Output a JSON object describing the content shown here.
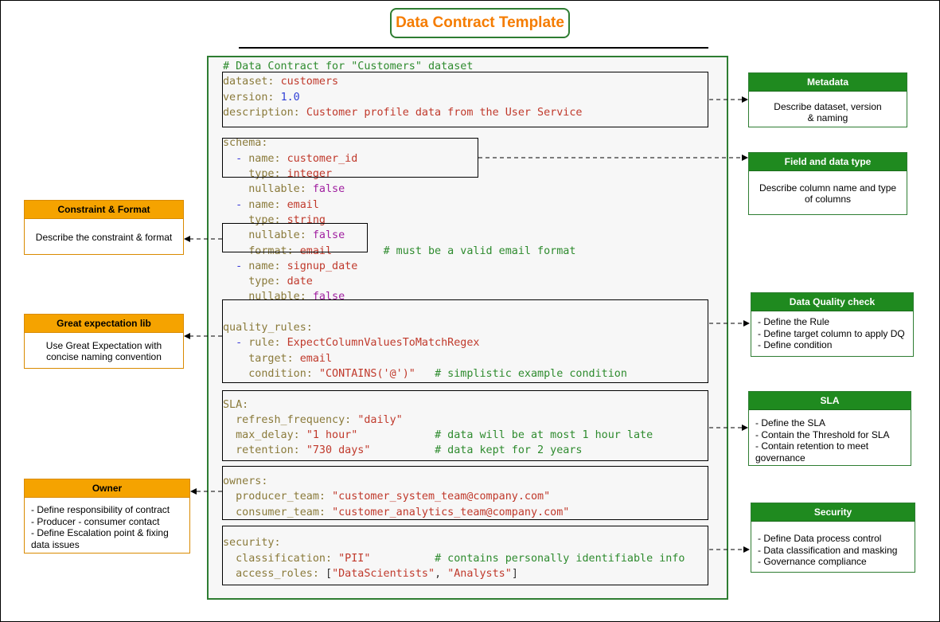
{
  "title": "Data Contract Template",
  "code": {
    "comment": "# Data Contract for \"Customers\" dataset",
    "dataset_key": "dataset:",
    "dataset_val": "customers",
    "version_key": "version:",
    "version_val": "1.0",
    "description_key": "description:",
    "description_val": "Customer profile data from the User Service",
    "schema_key": "schema:",
    "dash": "-",
    "name_key": "name:",
    "type_key": "type:",
    "nullable_key": "nullable:",
    "format_key": "format:",
    "false_val": "false",
    "field1_name": "customer_id",
    "field1_type": "integer",
    "field2_name": "email",
    "field2_type": "string",
    "field2_format": "email",
    "field2_comment": "# must be a valid email format",
    "field3_name": "signup_date",
    "field3_type": "date",
    "quality_key": "quality_rules:",
    "rule_key": "rule:",
    "rule_val": "ExpectColumnValuesToMatchRegex",
    "target_key": "target:",
    "target_val": "email",
    "condition_key": "condition:",
    "condition_val": "\"CONTAINS('@')\"",
    "condition_comment": "# simplistic example condition",
    "sla_key": "SLA:",
    "refresh_key": "refresh_frequency:",
    "refresh_val": "\"daily\"",
    "delay_key": "max_delay:",
    "delay_val": "\"1 hour\"",
    "delay_comment": "# data will be at most 1 hour late",
    "retention_key": "retention:",
    "retention_val": "\"730 days\"",
    "retention_comment": "# data kept for 2 years",
    "owners_key": "owners:",
    "producer_key": "producer_team:",
    "producer_val": "\"customer_system_team@company.com\"",
    "consumer_key": "consumer_team:",
    "consumer_val": "\"customer_analytics_team@company.com\"",
    "security_key": "security:",
    "classification_key": "classification:",
    "classification_val": "\"PII\"",
    "classification_comment": "# contains personally identifiable info",
    "roles_key": "access_roles:",
    "roles_open": "[",
    "role1": "\"DataScientists\"",
    "roles_sep": ", ",
    "role2": "\"Analysts\"",
    "roles_close": "]"
  },
  "boxes": {
    "metadata": {
      "header": "Metadata",
      "lines": [
        "Describe dataset, version",
        "& naming"
      ]
    },
    "field": {
      "header": "Field and data type",
      "lines": [
        "Describe column name and type",
        "of columns"
      ]
    },
    "quality": {
      "header": "Data Quality check",
      "lines": [
        "- Define the Rule",
        "- Define target column to apply DQ",
        "- Define condition"
      ]
    },
    "sla": {
      "header": "SLA",
      "lines": [
        "- Define the SLA",
        "- Contain the Threshold for SLA",
        "- Contain retention to meet",
        "governance"
      ]
    },
    "security": {
      "header": "Security",
      "lines": [
        "- Define Data process control",
        "- Data classification and masking",
        "- Governance compliance"
      ]
    },
    "constraint": {
      "header": "Constraint & Format",
      "lines": [
        "Describe the constraint & format"
      ]
    },
    "great": {
      "header": "Great expectation lib",
      "lines": [
        "Use Great Expectation with",
        "concise naming convention"
      ]
    },
    "owner": {
      "header": "Owner",
      "lines": [
        "- Define responsibility of contract",
        "- Producer - consumer contact",
        "- Define Escalation point & fixing",
        "data issues"
      ]
    }
  },
  "colors": {
    "green": "#2e7d32",
    "header_green": "#1f8a1f",
    "orange": "#f5a300",
    "title_orange": "#f57c00"
  }
}
